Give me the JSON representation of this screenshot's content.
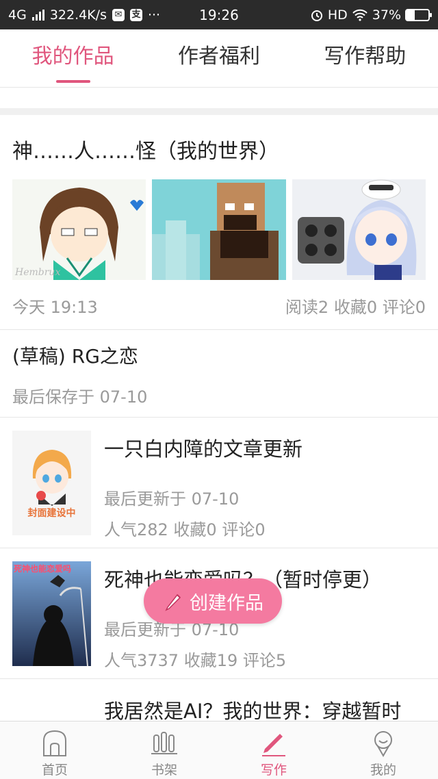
{
  "status_bar": {
    "network": "4G",
    "speed": "322.4K/s",
    "time": "19:26",
    "hd": "HD",
    "battery": "37%",
    "battery_level": 0.37,
    "dots": "···"
  },
  "tabs": [
    {
      "label": "我的作品",
      "active": true
    },
    {
      "label": "作者福利",
      "active": false
    },
    {
      "label": "写作帮助",
      "active": false
    }
  ],
  "works": [
    {
      "title": "神……人……怪（我的世界）",
      "time": "今天 19:13",
      "stats": "阅读2  收藏0  评论0"
    },
    {
      "title": "(草稿) RG之恋",
      "saved": "最后保存于 07-10"
    },
    {
      "title": "一只白内障的文章更新",
      "updated": "最后更新于 07-10",
      "stats": "人气282  收藏0  评论0",
      "cover_text": "封面建设中"
    },
    {
      "title": "死神也能恋爱吗？（暂时停更）",
      "updated": "最后更新于 07-10",
      "stats": "人气3737  收藏19  评论5",
      "cover_text": "死神也能恋爱吗"
    },
    {
      "title": "我居然是AI？我的世界：穿越暂时"
    }
  ],
  "fab": {
    "label": "创建作品"
  },
  "bottom_nav": [
    {
      "label": "首页",
      "icon": "home-icon"
    },
    {
      "label": "书架",
      "icon": "bookshelf-icon"
    },
    {
      "label": "写作",
      "icon": "pen-icon",
      "active": true
    },
    {
      "label": "我的",
      "icon": "user-icon"
    }
  ],
  "colors": {
    "accent": "#e0567d",
    "fab": "#f47aa0",
    "muted": "#9a9a9a"
  }
}
